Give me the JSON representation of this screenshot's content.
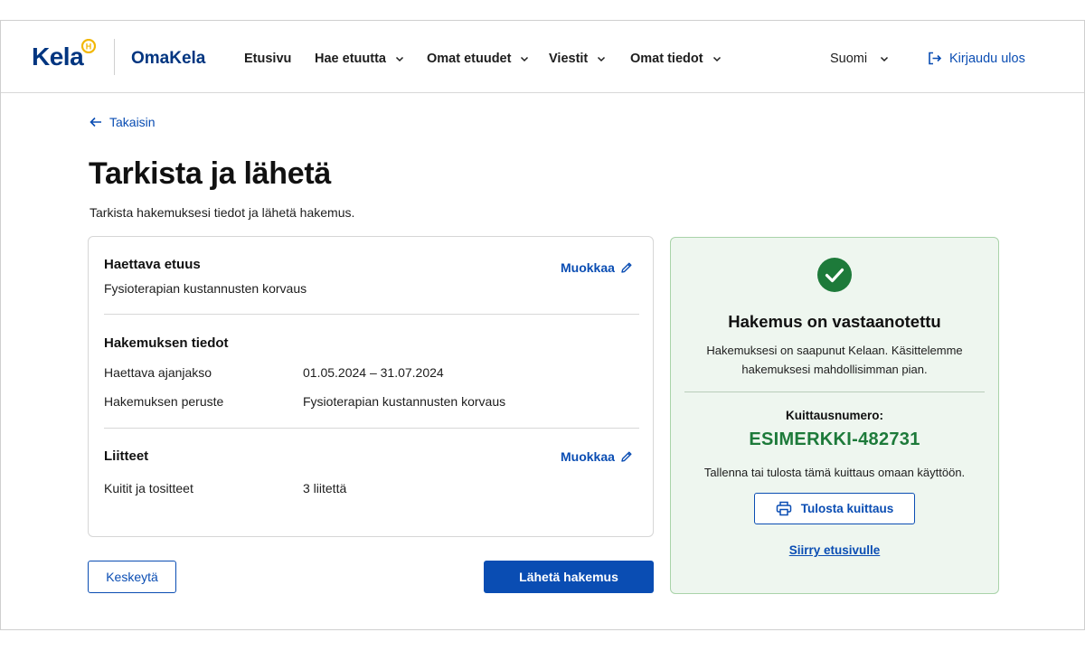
{
  "header": {
    "logo_text": "Kela",
    "app_name": "OmaKela",
    "nav": [
      {
        "label": "Etusivu",
        "has_dropdown": false
      },
      {
        "label": "Hae etuutta",
        "has_dropdown": true
      },
      {
        "label": "Omat etuudet",
        "has_dropdown": true
      },
      {
        "label": "Viestit",
        "has_dropdown": true
      },
      {
        "label": "Omat tiedot",
        "has_dropdown": true
      }
    ],
    "language": "Suomi",
    "logout": "Kirjaudu ulos"
  },
  "back_link": "Takaisin",
  "page": {
    "title": "Tarkista ja lähetä",
    "subtitle": "Tarkista hakemuksesi tiedot ja lähetä hakemus."
  },
  "summary": {
    "benefit": {
      "heading": "Haettava etuus",
      "value": "Fysioterapian kustannusten korvaus",
      "edit_label": "Muokkaa"
    },
    "details": {
      "heading": "Hakemuksen tiedot",
      "rows": [
        {
          "label": "Haettava ajanjakso",
          "value": "01.05.2024 – 31.07.2024"
        },
        {
          "label": "Hakemuksen peruste",
          "value": "Fysioterapian kustannusten korvaus"
        }
      ]
    },
    "attachments": {
      "heading": "Liitteet",
      "edit_label": "Muokkaa",
      "rows": [
        {
          "label": "Kuitit ja tositteet",
          "value": "3 liitettä"
        }
      ]
    }
  },
  "actions": {
    "cancel": "Keskeytä",
    "submit": "Lähetä hakemus"
  },
  "confirmation": {
    "title": "Hakemus on vastaanotettu",
    "body_line1": "Hakemuksesi on saapunut Kelaan. Käsittelemme",
    "body_line2": "hakemuksesi mahdollisimman pian.",
    "reference_label": "Kuittausnumero:",
    "reference_number": "ESIMERKKI-482731",
    "note": "Tallenna tai tulosta tämä kuittaus omaan käyttöön.",
    "print_button": "Tulosta kuittaus",
    "home_link": "Siirry etusivulle"
  },
  "colors": {
    "brand_blue": "#0a4db3",
    "logo_blue": "#003580",
    "logo_badge": "#f2b705",
    "success_green": "#1d7a3a",
    "panel_bg": "#eef6ef"
  },
  "icons": {
    "back": "arrow-left-icon",
    "logout": "logout-icon",
    "edit": "pencil-icon",
    "success": "check-circle-icon",
    "print": "printer-icon",
    "dropdown": "chevron-down-icon"
  }
}
